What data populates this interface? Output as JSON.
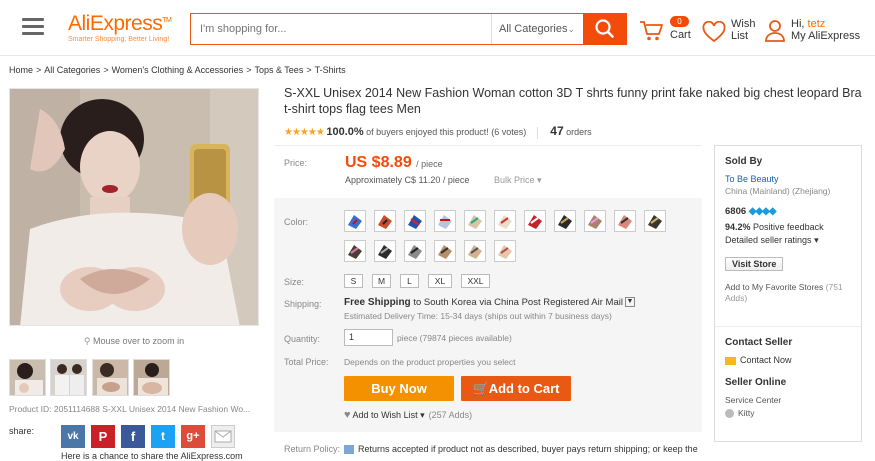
{
  "header": {
    "logo_main": "AliExpress",
    "logo_tm": "TM",
    "logo_sub": "Smarter Shopping, Better Living!",
    "search_placeholder": "I'm shopping for...",
    "category": "All Categories",
    "cart_count": "0",
    "cart_label": "Cart",
    "wish_label_1": "Wish",
    "wish_label_2": "List",
    "greeting": "Hi,",
    "username": "tetz",
    "account": "My AliExpress"
  },
  "breadcrumb": [
    "Home",
    "All Categories",
    "Women's Clothing & Accessories",
    "Tops & Tees",
    "T-Shirts"
  ],
  "breadcrumb_sep": ">",
  "gallery": {
    "zoom_hint": "Mouse over to zoom in",
    "product_id": "Product ID: 2051114688 S-XXL Unisex 2014 New Fashion Wo...",
    "share_label": "share:",
    "share_note": "Here is a chance to share the AliExpress.com"
  },
  "product": {
    "title": "S-XXL Unisex 2014 New Fashion Woman cotton 3D T shrts funny print fake naked big chest leopard Bra t-shirt tops flag tees Men",
    "stars": "★★★★★",
    "rating_pct": "100.0%",
    "rating_text": "of buyers enjoyed this product! (6 votes)",
    "orders_count": "47",
    "orders_label": "orders",
    "price_label": "Price:",
    "price": "US $8.89",
    "price_unit": "/ piece",
    "price_approx": "Approximately C$ 11.20 / piece",
    "bulk_price": "Bulk Price",
    "color_label": "Color:",
    "size_label": "Size:",
    "sizes": [
      "S",
      "M",
      "L",
      "XL",
      "XXL"
    ],
    "shipping_label": "Shipping:",
    "shipping_free": "Free Shipping",
    "shipping_text": "to South Korea via China Post Registered Air Mail",
    "delivery": "Estimated Delivery Time: 15-34 days (ships out within 7 business days)",
    "quantity_label": "Quantity:",
    "quantity": "1",
    "quantity_note": "piece (79874 pieces available)",
    "total_label": "Total Price:",
    "total_value": "Depends on the product properties you select",
    "buy_now": "Buy Now",
    "add_to_cart": "Add to Cart",
    "add_wishlist": "Add to Wish List",
    "wish_count": "(257 Adds)",
    "return_label": "Return Policy:",
    "return_text": "Returns accepted if product not as described, buyer pays return shipping; or keep the"
  },
  "seller": {
    "sold_by": "Sold By",
    "store": "To Be Beauty",
    "location": "China (Mainland) (Zhejiang)",
    "score": "6806",
    "feedback_pct": "94.2%",
    "feedback_text": "Positive feedback",
    "ratings_link": "Detailed seller ratings",
    "visit_store": "Visit Store",
    "favorite": "Add to My Favorite Stores",
    "favorite_count": "(751 Adds)",
    "contact_title": "Contact Seller",
    "contact_now": "Contact Now",
    "online_title": "Seller Online",
    "service": "Service Center",
    "agent": "Kitty"
  }
}
